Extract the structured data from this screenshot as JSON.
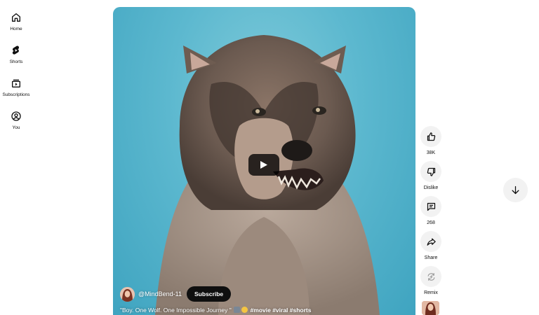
{
  "nav": {
    "items": [
      {
        "label": "Home",
        "icon": "home-icon"
      },
      {
        "label": "Shorts",
        "icon": "shorts-icon"
      },
      {
        "label": "Subscriptions",
        "icon": "subscriptions-icon"
      },
      {
        "label": "You",
        "icon": "account-icon"
      }
    ]
  },
  "video": {
    "channel_handle": "@MindBend-11",
    "subscribe_label": "Subscribe",
    "caption_text": "\"Boy. One Wolf. One Impossible Journey \"",
    "caption_tags": "#movie #viral #shorts"
  },
  "actions": {
    "like_count": "38K",
    "dislike_label": "Dislike",
    "comment_count": "268",
    "share_label": "Share",
    "remix_label": "Remix"
  },
  "colors": {
    "accent": "#0f0f0f",
    "button_bg": "#f2f2f2",
    "sky": "#5cb8cf"
  }
}
